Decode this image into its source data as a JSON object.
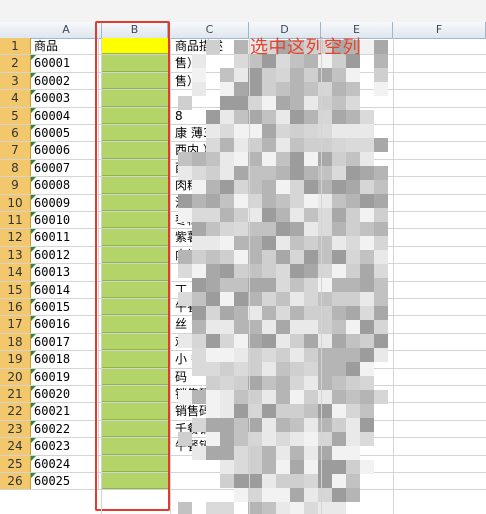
{
  "columns": [
    "A",
    "B",
    "C",
    "D",
    "E",
    "F"
  ],
  "annotation": "选中这列空列",
  "rows": [
    {
      "num": "1",
      "a": "商品",
      "c": "商品描述",
      "header": true
    },
    {
      "num": "2",
      "a": "60001",
      "c": "                    售）"
    },
    {
      "num": "3",
      "a": "60002",
      "c": "                    售）"
    },
    {
      "num": "4",
      "a": "60003",
      "c": ""
    },
    {
      "num": "5",
      "a": "60004",
      "c": "8"
    },
    {
      "num": "6",
      "a": "60005",
      "c": "康  薄350ml*1      用水"
    },
    {
      "num": "7",
      "a": "60006",
      "c": "          西内      ）"
    },
    {
      "num": "8",
      "a": "60007",
      "c": "          西内      ）"
    },
    {
      "num": "9",
      "a": "60008",
      "c": "          肉粽      包粽    售）"
    },
    {
      "num": "10",
      "a": "60009",
      "c": "          沙粽      包粽    售）"
    },
    {
      "num": "11",
      "a": "60010",
      "c": "          枣粽      包粽    售）"
    },
    {
      "num": "12",
      "a": "60011",
      "c": "          紫薯      圆"
    },
    {
      "num": "13",
      "a": "60012",
      "c": "                    内销"
    },
    {
      "num": "14",
      "a": "60013",
      "c": ""
    },
    {
      "num": "15",
      "a": "60014",
      "c": "          丁（      "
    },
    {
      "num": "16",
      "a": "60015",
      "c": "          午餐      售）"
    },
    {
      "num": "17",
      "a": "60016",
      "c": "          丝（      销售"
    },
    {
      "num": "18",
      "a": "60017",
      "c": "          鸡蛋          千餐     码）"
    },
    {
      "num": "19",
      "a": "60018",
      "c": "                   小        餐销售码）"
    },
    {
      "num": "20",
      "a": "60019",
      "c": "                    码"
    },
    {
      "num": "21",
      "a": "60020",
      "c": "                    销售码"
    },
    {
      "num": "22",
      "a": "60021",
      "c": "                    销售码"
    },
    {
      "num": "23",
      "a": "60022",
      "c": "                    千餐销售"
    },
    {
      "num": "24",
      "a": "60023",
      "c": "                    午餐销售"
    },
    {
      "num": "25",
      "a": "60024",
      "c": "                    "
    },
    {
      "num": "26",
      "a": "60025",
      "c": ""
    }
  ]
}
